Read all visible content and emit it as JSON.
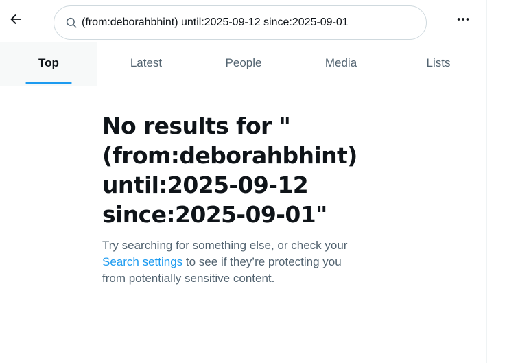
{
  "header": {
    "back_icon": "arrow-left-icon",
    "search": {
      "icon": "search-icon",
      "value": "(from:deborahbhint) until:2025-09-12 since:2025-09-01",
      "placeholder": "Search"
    },
    "more_icon": "more-horizontal-icon"
  },
  "tabs": [
    {
      "label": "Top",
      "active": true
    },
    {
      "label": "Latest",
      "active": false
    },
    {
      "label": "People",
      "active": false
    },
    {
      "label": "Media",
      "active": false
    },
    {
      "label": "Lists",
      "active": false
    }
  ],
  "empty_state": {
    "title": "No results for \"\n(from:deborahbhint)\nuntil:2025-09-12\nsince:2025-09-01\"",
    "body_line1": "Try searching for something else, or check your",
    "link_text": "Search settings",
    "body_line2_rest": " to see if they’re protecting you",
    "body_line3": "from potentially sensitive content."
  },
  "colors": {
    "accent": "#1d9bf0",
    "text_primary": "#0f1419",
    "text_secondary": "#536471",
    "border": "#eff3f4"
  }
}
